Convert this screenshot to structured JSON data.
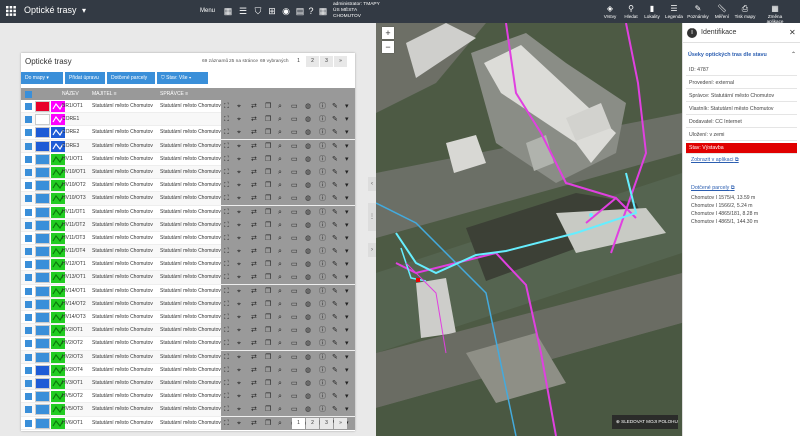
{
  "app": {
    "title": "Optické trasy",
    "menu_label": "Menu"
  },
  "user": {
    "line1": "administrator: TMAPY",
    "line2": "ÚS MĚSTA",
    "line3": "CHOMUTOV"
  },
  "right_tools": [
    {
      "label": "Vrstvy",
      "icon": "layers-icon"
    },
    {
      "label": "Hledat",
      "icon": "search-icon"
    },
    {
      "label": "Lokality",
      "icon": "bookmark-icon"
    },
    {
      "label": "Legenda",
      "icon": "legend-icon"
    },
    {
      "label": "Poznámky",
      "icon": "notes-icon"
    },
    {
      "label": "Měření",
      "icon": "ruler-icon"
    },
    {
      "label": "Tisk mapy",
      "icon": "print-icon"
    },
    {
      "label": "Změna aplikace",
      "icon": "apps-icon"
    }
  ],
  "table_card": {
    "title": "Optické trasy",
    "records": "69 záznamů",
    "per_page": "25 na stránce",
    "selected": "69 vybraných",
    "pages": [
      "1",
      "2",
      "3",
      "»"
    ],
    "buttons": {
      "to_map": "Do mapy",
      "add": "Přidat úpravu",
      "parcels": "Dotčené parcely",
      "filter": "Stav: Vše"
    },
    "columns": {
      "name": "NÁZEV",
      "owner": "MAJITEL",
      "manager": "SPRÁVCE"
    },
    "rows": [
      {
        "name": "BR1/OT1",
        "owner": "Statutární město Chomutov",
        "manager": "Statutární město Chomutov",
        "color": "#e8002a",
        "line": "#ff00ff"
      },
      {
        "name": "CORE1",
        "owner": "",
        "manager": "",
        "color": "#ffffff",
        "line": "#ff00ff"
      },
      {
        "name": "CORE2",
        "owner": "Statutární město Chomutov",
        "manager": "Statutární město Chomutov",
        "color": "#1e5bd6",
        "line": "#1e5bd6"
      },
      {
        "name": "CORE3",
        "owner": "Statutární město Chomutov",
        "manager": "Statutární město Chomutov",
        "color": "#1e5bd6",
        "line": "#1e5bd6"
      },
      {
        "name": "HV1/OT1",
        "owner": "Statutární město Chomutov",
        "manager": "Statutární město Chomutov",
        "color": "#3a8fd9",
        "line": "#22cc22"
      },
      {
        "name": "HV10/OT1",
        "owner": "Statutární město Chomutov",
        "manager": "Statutární město Chomutov",
        "color": "#3a8fd9",
        "line": "#22cc22"
      },
      {
        "name": "HV10/OT2",
        "owner": "Statutární město Chomutov",
        "manager": "Statutární město Chomutov",
        "color": "#3a8fd9",
        "line": "#22cc22"
      },
      {
        "name": "HV10/OT3",
        "owner": "Statutární město Chomutov",
        "manager": "Statutární město Chomutov",
        "color": "#3a8fd9",
        "line": "#22cc22"
      },
      {
        "name": "HV11/OT1",
        "owner": "Statutární město Chomutov",
        "manager": "Statutární město Chomutov",
        "color": "#3a8fd9",
        "line": "#22cc22"
      },
      {
        "name": "HV11/OT2",
        "owner": "Statutární město Chomutov",
        "manager": "Statutární město Chomutov",
        "color": "#3a8fd9",
        "line": "#22cc22"
      },
      {
        "name": "HV11/OT3",
        "owner": "Statutární město Chomutov",
        "manager": "Statutární město Chomutov",
        "color": "#3a8fd9",
        "line": "#22cc22"
      },
      {
        "name": "HV11/OT4",
        "owner": "Statutární město Chomutov",
        "manager": "Statutární město Chomutov",
        "color": "#3a8fd9",
        "line": "#22cc22"
      },
      {
        "name": "HV12/OT1",
        "owner": "Statutární město Chomutov",
        "manager": "Statutární město Chomutov",
        "color": "#3a8fd9",
        "line": "#22cc22"
      },
      {
        "name": "HV13/OT1",
        "owner": "Statutární město Chomutov",
        "manager": "Statutární město Chomutov",
        "color": "#3a8fd9",
        "line": "#22cc22"
      },
      {
        "name": "HV14/OT1",
        "owner": "Statutární město Chomutov",
        "manager": "Statutární město Chomutov",
        "color": "#3a8fd9",
        "line": "#22cc22"
      },
      {
        "name": "HV14/OT2",
        "owner": "Statutární město Chomutov",
        "manager": "Statutární město Chomutov",
        "color": "#3a8fd9",
        "line": "#22cc22"
      },
      {
        "name": "HV14/OT3",
        "owner": "Statutární město Chomutov",
        "manager": "Statutární město Chomutov",
        "color": "#3a8fd9",
        "line": "#22cc22"
      },
      {
        "name": "HV2/OT1",
        "owner": "Statutární město Chomutov",
        "manager": "Statutární město Chomutov",
        "color": "#3a8fd9",
        "line": "#22cc22"
      },
      {
        "name": "HV2/OT2",
        "owner": "Statutární město Chomutov",
        "manager": "Statutární město Chomutov",
        "color": "#3a8fd9",
        "line": "#22cc22"
      },
      {
        "name": "HV2/OT3",
        "owner": "Statutární město Chomutov",
        "manager": "Statutární město Chomutov",
        "color": "#3a8fd9",
        "line": "#22cc22"
      },
      {
        "name": "HV2/OT4",
        "owner": "Statutární město Chomutov",
        "manager": "Statutární město Chomutov",
        "color": "#1e5bd6",
        "line": "#22cc22"
      },
      {
        "name": "HV3/OT1",
        "owner": "Statutární město Chomutov",
        "manager": "Statutární město Chomutov",
        "color": "#1e5bd6",
        "line": "#22cc22"
      },
      {
        "name": "HV5/OT2",
        "owner": "Statutární město Chomutov",
        "manager": "Statutární město Chomutov",
        "color": "#3a8fd9",
        "line": "#22cc22"
      },
      {
        "name": "HV5/OT3",
        "owner": "Statutární město Chomutov",
        "manager": "Statutární město Chomutov",
        "color": "#3a8fd9",
        "line": "#22cc22"
      },
      {
        "name": "HV6/OT1",
        "owner": "Statutární město Chomutov",
        "manager": "Statutární město Chomutov",
        "color": "#3a8fd9",
        "line": "#22cc22"
      }
    ]
  },
  "identify": {
    "title": "Identifikace",
    "section": "Úseky optických tras dle stavu",
    "fields": [
      "ID: 4787",
      "Provedení: external",
      "Správce: Statutární město Chomutov",
      "Vlastník: Statutární město Chomutov",
      "Dodavatel: CC Internet",
      "Uložení: v zemi",
      "Stav: Výstavba"
    ],
    "show_in_app": "Zobrazit v aplikaci",
    "parcels_title": "Dotčené parcely",
    "parcels": [
      "Chomutov I 1575/4, 13.59 m",
      "Chomutov I 1566/2, 5.24 m",
      "Chomutov I 4865/181, 8.28 m",
      "Chomutov I 4865/1, 144.30 m"
    ]
  },
  "map": {
    "follow_label": "SLEDOVAT MOJI POLOHU"
  }
}
